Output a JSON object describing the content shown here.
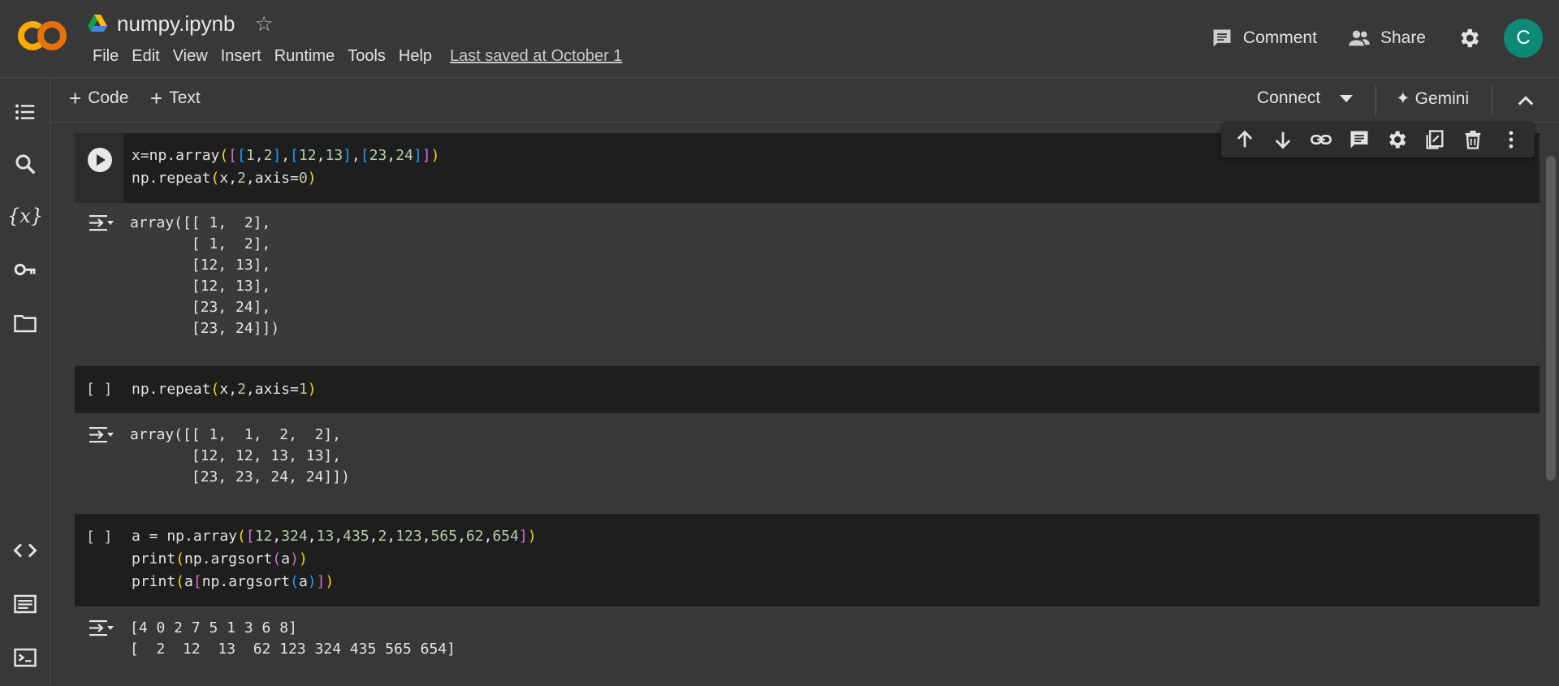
{
  "header": {
    "doc_title": "numpy.ipynb",
    "menu": [
      "File",
      "Edit",
      "View",
      "Insert",
      "Runtime",
      "Tools",
      "Help"
    ],
    "last_saved": "Last saved at October 1",
    "comment_label": "Comment",
    "share_label": "Share",
    "avatar_letter": "C",
    "avatar_color": "#0d8a76"
  },
  "toolbar": {
    "code_label": "Code",
    "text_label": "Text",
    "connect_label": "Connect",
    "gemini_label": "Gemini"
  },
  "cells": [
    {
      "status": "run-button",
      "code": [
        "x=np.array([[1,2],[12,13],[23,24]])",
        "np.repeat(x,2,axis=0)"
      ],
      "output": [
        "array([[ 1,  2],",
        "       [ 1,  2],",
        "       [12, 13],",
        "       [12, 13],",
        "       [23, 24],",
        "       [23, 24]])"
      ]
    },
    {
      "status": "[ ]",
      "code": [
        "np.repeat(x,2,axis=1)"
      ],
      "output": [
        "array([[ 1,  1,  2,  2],",
        "       [12, 12, 13, 13],",
        "       [23, 23, 24, 24]])"
      ]
    },
    {
      "status": "[ ]",
      "code": [
        "a = np.array([12,324,13,435,2,123,565,62,654])",
        "print(np.argsort(a))",
        "print(a[np.argsort(a)])"
      ],
      "output": [
        "[4 0 2 7 5 1 3 6 8]",
        "[  2  12  13  62 123 324 435 565 654]"
      ]
    }
  ],
  "icons": {
    "rail": [
      "table-of-contents-icon",
      "search-icon",
      "variables-icon",
      "secrets-key-icon",
      "files-folder-icon",
      "code-snippets-icon",
      "command-palette-icon",
      "terminal-icon"
    ],
    "cell_toolbar": [
      "move-up-icon",
      "move-down-icon",
      "link-icon",
      "comment-icon",
      "settings-icon",
      "mirror-cell-icon",
      "delete-icon",
      "more-vert-icon"
    ]
  }
}
